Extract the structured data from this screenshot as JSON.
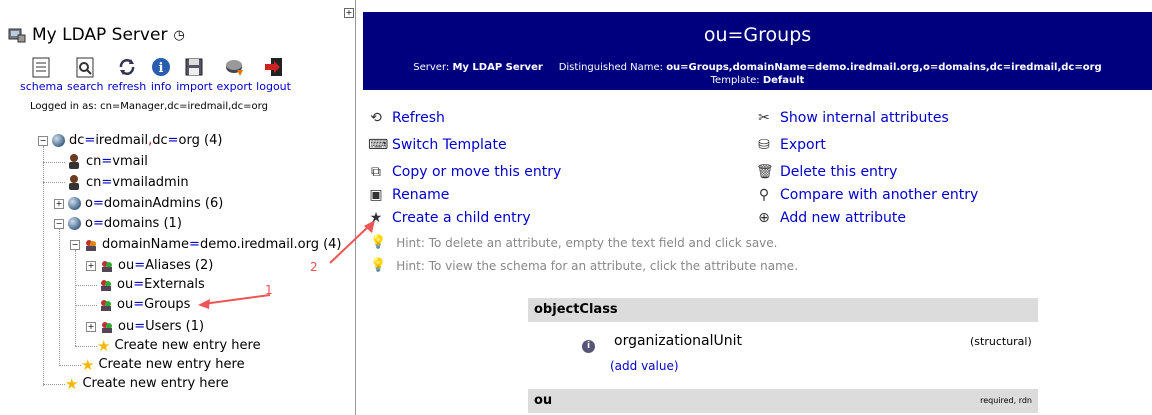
{
  "left": {
    "server_title": "My LDAP Server",
    "toolbar": [
      {
        "id": "schema",
        "label": "schema",
        "icon": "schema-icon"
      },
      {
        "id": "search",
        "label": "search",
        "icon": "search-icon"
      },
      {
        "id": "refresh",
        "label": "refresh",
        "icon": "refresh-icon"
      },
      {
        "id": "info",
        "label": "info",
        "icon": "info-icon"
      },
      {
        "id": "import",
        "label": "import",
        "icon": "import-icon"
      },
      {
        "id": "export",
        "label": "export",
        "icon": "export-icon"
      },
      {
        "id": "logout",
        "label": "logout",
        "icon": "logout-icon"
      }
    ],
    "logged_in": "Logged in as: cn=Manager,dc=iredmail,dc=org",
    "tree": {
      "root": {
        "a": "dc",
        "b": "iredmail",
        "c": "dc",
        "d": "org",
        "count": "(4)"
      },
      "vmail": {
        "k": "cn",
        "v": "vmail"
      },
      "vmailadmin": {
        "k": "cn",
        "v": "vmailadmin"
      },
      "domainadmins": {
        "k": "o",
        "v": "domainAdmins",
        "count": "(6)"
      },
      "domains": {
        "k": "o",
        "v": "domains",
        "count": "(1)"
      },
      "domainname": {
        "k": "domainName",
        "v": "demo.iredmail.org",
        "count": "(4)"
      },
      "aliases": {
        "k": "ou",
        "v": "Aliases",
        "count": "(2)"
      },
      "externals": {
        "k": "ou",
        "v": "Externals"
      },
      "groups": {
        "k": "ou",
        "v": "Groups"
      },
      "users": {
        "k": "ou",
        "v": "Users",
        "count": "(1)"
      },
      "create1": "Create new entry here",
      "create2": "Create new entry here",
      "create3": "Create new entry here"
    },
    "annotation1": "1",
    "annotation2": "2"
  },
  "right": {
    "title": "ou=Groups",
    "server_label": "Server:",
    "server_value": "My LDAP Server",
    "dn_label": "Distinguished Name:",
    "dn_value": "ou=Groups,domainName=demo.iredmail.org,o=domains,dc=iredmail,dc=org",
    "template_label": "Template:",
    "template_value": "Default",
    "actions_left": [
      "Refresh",
      "Switch Template",
      "Copy or move this entry",
      "Rename",
      "Create a child entry"
    ],
    "actions_right": [
      "Show internal attributes",
      "Export",
      "Delete this entry",
      "Compare with another entry",
      "Add new attribute"
    ],
    "hints": [
      "Hint: To delete an attribute, empty the text field and click save.",
      "Hint: To view the schema for an attribute, click the attribute name."
    ],
    "objectclass": {
      "header": "objectClass",
      "value": "organizationalUnit",
      "kind": "(structural)",
      "add": "(add value)"
    },
    "ou": {
      "header": "ou",
      "flags": "required, rdn"
    }
  }
}
